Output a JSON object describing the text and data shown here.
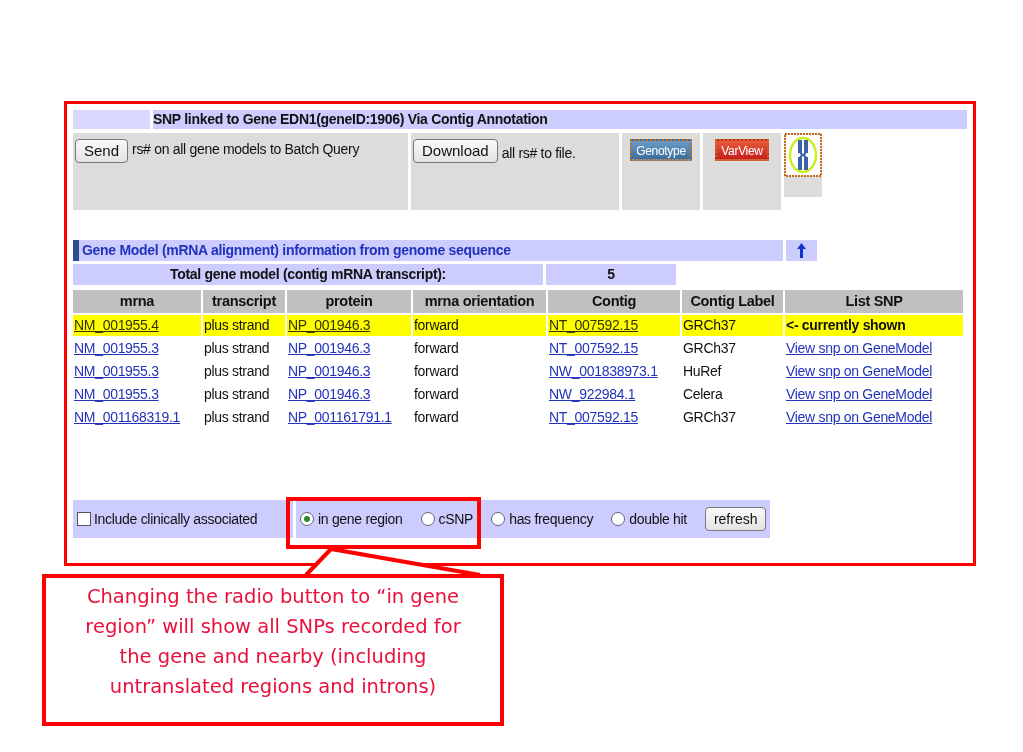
{
  "title": "SNP linked to Gene EDN1(geneID:1906) Via Contig Annotation",
  "toolbar": {
    "send_button": "Send",
    "send_text": "rs# on all gene models to Batch Query",
    "download_button": "Download",
    "download_text": "all rs# to file.",
    "genotype_button": "Genotype",
    "varview_button": "VarView"
  },
  "section_title": "Gene Model (mRNA alignment) information from genome sequence",
  "total": {
    "label": "Total gene model (contig mRNA transcript):",
    "value": "5"
  },
  "table": {
    "columns": [
      "mrna",
      "transcript",
      "protein",
      "mrna orientation",
      "Contig",
      "Contig Label",
      "List SNP"
    ],
    "rows": [
      {
        "selected": true,
        "mrna": "NM_001955.4",
        "transcript": "plus strand",
        "protein": "NP_001946.3",
        "orientation": "forward",
        "contig": "NT_007592.15",
        "contig_label": "GRCh37",
        "list_snp": "<- currently shown"
      },
      {
        "selected": false,
        "mrna": "NM_001955.3",
        "transcript": "plus strand",
        "protein": "NP_001946.3",
        "orientation": "forward",
        "contig": "NT_007592.15",
        "contig_label": "GRCh37",
        "list_snp": "View snp on GeneModel"
      },
      {
        "selected": false,
        "mrna": "NM_001955.3",
        "transcript": "plus strand",
        "protein": "NP_001946.3",
        "orientation": "forward",
        "contig": "NW_001838973.1",
        "contig_label": "HuRef",
        "list_snp": "View snp on GeneModel"
      },
      {
        "selected": false,
        "mrna": "NM_001955.3",
        "transcript": "plus strand",
        "protein": "NP_001946.3",
        "orientation": "forward",
        "contig": "NW_922984.1",
        "contig_label": "Celera",
        "list_snp": "View snp on GeneModel"
      },
      {
        "selected": false,
        "mrna": "NM_001168319.1",
        "transcript": "plus strand",
        "protein": "NP_001161791.1",
        "orientation": "forward",
        "contig": "NT_007592.15",
        "contig_label": "GRCh37",
        "list_snp": "View snp on GeneModel"
      }
    ]
  },
  "options": {
    "checkbox": {
      "label": "Include clinically associated",
      "checked": false
    },
    "radios": [
      {
        "label": "in gene region",
        "selected": true
      },
      {
        "label": "cSNP",
        "selected": false
      },
      {
        "label": "has frequency",
        "selected": false
      },
      {
        "label": "double hit",
        "selected": false
      }
    ],
    "refresh_button": "refresh"
  },
  "callout": "Changing the radio button to “in gene region” will show all SNPs recorded for the gene and nearby (including untranslated regions and introns)"
}
